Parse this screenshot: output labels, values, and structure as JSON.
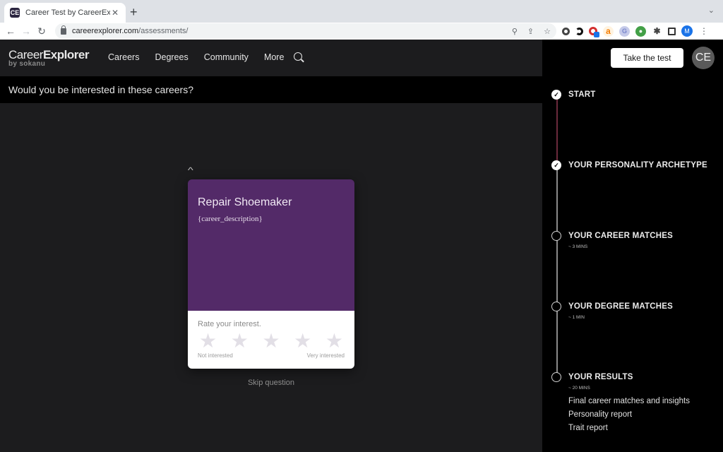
{
  "browser": {
    "tab_title": "Career Test by CareerExplorer",
    "tab_favicon": "CE",
    "url_host": "careerexplorer.com",
    "url_path": "/assessments/",
    "profile_initial": "M",
    "extensions": [
      "extension-icon-1",
      "extension-icon-2",
      "extension-icon-opera",
      "extension-icon-amazon",
      "extension-icon-grammarly",
      "extension-icon-green",
      "puzzle-icon",
      "sidepanel-icon"
    ]
  },
  "header": {
    "logo_main_a": "Career",
    "logo_main_b": "Explorer",
    "logo_sub": "by sokanu",
    "nav": [
      "Careers",
      "Degrees",
      "Community",
      "More"
    ]
  },
  "question": {
    "text": "Would you be interested in these careers?"
  },
  "card": {
    "title": "Repair Shoemaker",
    "description": "{career_description}",
    "rate_label": "Rate your interest.",
    "stars_total": 5,
    "stars_selected": 0,
    "low_label": "Not interested",
    "high_label": "Very interested",
    "background_color": "#532a68"
  },
  "skip_label": "Skip question",
  "sidebar": {
    "take_test_label": "Take the test",
    "avatar_initials": "CE",
    "steps": [
      {
        "title": "START",
        "status": "done",
        "time": "",
        "items": []
      },
      {
        "title": "YOUR PERSONALITY ARCHETYPE",
        "status": "done",
        "time": "",
        "items": []
      },
      {
        "title": "YOUR CAREER MATCHES",
        "status": "todo",
        "time": "~ 3 MINS",
        "items": []
      },
      {
        "title": "YOUR DEGREE MATCHES",
        "status": "todo",
        "time": "~ 1 MIN",
        "items": []
      },
      {
        "title": "YOUR RESULTS",
        "status": "todo",
        "time": "~ 20 MINS",
        "items": [
          "Final career matches and insights",
          "Personality report",
          "Trait report"
        ]
      }
    ]
  }
}
